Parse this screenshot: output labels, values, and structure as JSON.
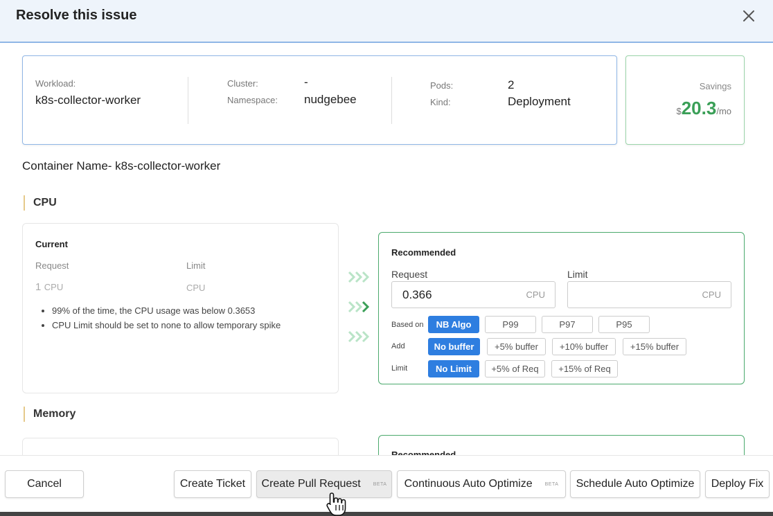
{
  "dialog": {
    "title": "Resolve this issue"
  },
  "workload": {
    "workload_label": "Workload:",
    "workload_value": "k8s-collector-worker",
    "cluster_label": "Cluster:",
    "cluster_value": "-",
    "namespace_label": "Namespace:",
    "namespace_value": "nudgebee",
    "pods_label": "Pods:",
    "pods_value": "2",
    "kind_label": "Kind:",
    "kind_value": "Deployment"
  },
  "savings": {
    "label": "Savings",
    "currency": "$",
    "value": "20.3",
    "unit": "/mo"
  },
  "container_name": "Container Name- k8s-collector-worker",
  "cpu": {
    "section_title": "CPU",
    "current": {
      "title": "Current",
      "request_label": "Request",
      "limit_label": "Limit",
      "request_num": "1",
      "request_unit": "CPU",
      "limit_unit": "CPU",
      "notes": [
        "99% of the time, the CPU usage was below 0.3653",
        "CPU Limit should be set to none to allow temporary spike"
      ]
    },
    "recommended": {
      "title": "Recommended",
      "request_label": "Request",
      "limit_label": "Limit",
      "request_value": "0.366",
      "request_unit": "CPU",
      "limit_value": "",
      "limit_unit": "CPU",
      "based_on_label": "Based on",
      "based_on_options": [
        "NB Algo",
        "P99",
        "P97",
        "P95"
      ],
      "add_label": "Add",
      "add_options": [
        "No buffer",
        "+5% buffer",
        "+10% buffer",
        "+15% buffer"
      ],
      "limit_row_label": "Limit",
      "limit_options": [
        "No Limit",
        "+5% of Req",
        "+15% of Req"
      ]
    }
  },
  "memory": {
    "section_title": "Memory",
    "recommended_title": "Recommended"
  },
  "footer": {
    "cancel": "Cancel",
    "create_ticket": "Create Ticket",
    "create_pr": "Create Pull Request",
    "create_pr_badge": "BETA",
    "continuous": "Continuous Auto Optimize",
    "continuous_badge": "BETA",
    "schedule": "Schedule Auto Optimize",
    "deploy": "Deploy Fix"
  },
  "colors": {
    "primary": "#2e7ee0",
    "success": "#3a9f57",
    "recommended_border": "#4aa96c",
    "header_bg": "#eef4fb"
  },
  "icons": {
    "close": "close-icon",
    "chevrons": "chevron-right-icon",
    "cursor": "hand-pointer-icon"
  }
}
